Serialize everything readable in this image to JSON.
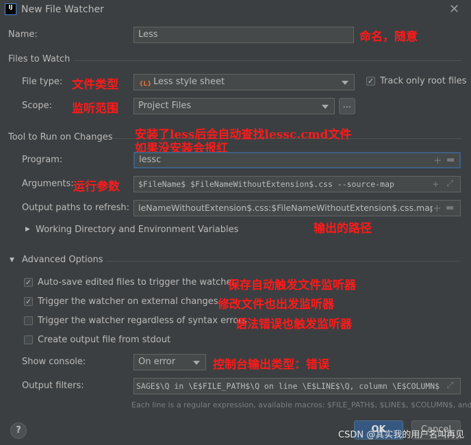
{
  "window": {
    "title": "New File Watcher",
    "app_icon": "intellij-icon",
    "close_icon": "close-icon"
  },
  "name": {
    "label": "Name:",
    "value": "Less"
  },
  "files_to_watch": {
    "section": "Files to Watch",
    "file_type_label": "File type:",
    "file_type_value": "Less style sheet",
    "track_root_label": "Track only root files",
    "track_root_checked": true,
    "scope_label": "Scope:",
    "scope_value": "Project Files",
    "scope_more": "..."
  },
  "tool": {
    "section": "Tool to Run on Changes",
    "program_label": "Program:",
    "program_value": "lessc",
    "arguments_label": "Arguments:",
    "arguments_value": "$FileName$ $FileNameWithoutExtension$.css --source-map",
    "output_label": "Output paths to refresh:",
    "output_value": "leNameWithoutExtension$.css:$FileNameWithoutExtension$.css.map",
    "working_dir": "Working Directory and Environment Variables"
  },
  "advanced": {
    "section": "Advanced Options",
    "options": [
      {
        "label": "Auto-save edited files to trigger the watcher",
        "checked": true
      },
      {
        "label": "Trigger the watcher on external changes",
        "checked": true
      },
      {
        "label": "Trigger the watcher regardless of syntax errors",
        "checked": false
      },
      {
        "label": "Create output file from stdout",
        "checked": false
      }
    ],
    "show_console_label": "Show console:",
    "show_console_value": "On error",
    "output_filters_label": "Output filters:",
    "output_filters_value": "SAGE$\\Q in \\E$FILE_PATH$\\Q on line \\E$LINE$\\Q, column \\E$COLUMN$",
    "hint": "Each line is a regular expression, available macros: $FILE_PATH$, $LINE$, $COLUMN$, and ..."
  },
  "buttons": {
    "help": "?",
    "ok": "OK",
    "cancel": "Cancel"
  },
  "annotations": {
    "name": "命名，随意",
    "file_type": "文件类型",
    "scope": "监听范围",
    "program1": "安装了less后会自动查找lessc.cmd文件",
    "program2": "如果没安装会报红",
    "arguments": "运行参数",
    "output": "输出的路径",
    "opt0": "保存自动触发文件监听器",
    "opt1": "修改文件也出发监听器",
    "opt2": "语法错误也触发监听器",
    "console": "控制台输出类型：错误"
  },
  "watermark": "CSDN @其实我的用户名叫再见",
  "colors": {
    "background": "#3c3f41",
    "field": "#45494a",
    "focus": "#3d6185",
    "ok_button": "#365880",
    "annotation": "#ff1a1a"
  }
}
